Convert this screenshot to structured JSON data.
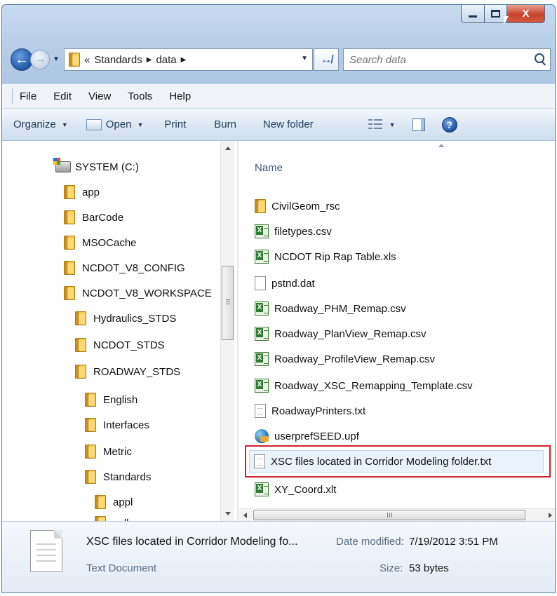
{
  "window": {
    "close_label": "X"
  },
  "address": {
    "overflow": "«",
    "crumbs": [
      "Standards",
      "data"
    ],
    "search_placeholder": "Search data"
  },
  "menu": [
    "File",
    "Edit",
    "View",
    "Tools",
    "Help"
  ],
  "toolbar": {
    "organize": "Organize",
    "open": "Open",
    "print": "Print",
    "burn": "Burn",
    "new_folder": "New folder"
  },
  "nav_tree": [
    {
      "label": "SYSTEM (C:)",
      "type": "drive"
    },
    {
      "label": "app",
      "type": "folder"
    },
    {
      "label": "BarCode",
      "type": "folder"
    },
    {
      "label": "MSOCache",
      "type": "folder"
    },
    {
      "label": "NCDOT_V8_CONFIG",
      "type": "folder"
    },
    {
      "label": "NCDOT_V8_WORKSPACE",
      "type": "folder"
    },
    {
      "label": "Hydraulics_STDS",
      "type": "folder"
    },
    {
      "label": "NCDOT_STDS",
      "type": "folder"
    },
    {
      "label": "ROADWAY_STDS",
      "type": "folder"
    },
    {
      "label": "English",
      "type": "folder"
    },
    {
      "label": "Interfaces",
      "type": "folder"
    },
    {
      "label": "Metric",
      "type": "folder"
    },
    {
      "label": "Standards",
      "type": "folder"
    },
    {
      "label": "appl",
      "type": "folder"
    },
    {
      "label": "cell",
      "type": "folder"
    }
  ],
  "content": {
    "column_name": "Name",
    "files": [
      {
        "name": "CivilGeom_rsc",
        "icon": "folder-icon"
      },
      {
        "name": "filetypes.csv",
        "icon": "excel-icon"
      },
      {
        "name": "NCDOT Rip Rap Table.xls",
        "icon": "excel-icon"
      },
      {
        "name": "pstnd.dat",
        "icon": "blank-file-icon"
      },
      {
        "name": "Roadway_PHM_Remap.csv",
        "icon": "excel-icon"
      },
      {
        "name": "Roadway_PlanView_Remap.csv",
        "icon": "excel-icon"
      },
      {
        "name": "Roadway_ProfileView_Remap.csv",
        "icon": "excel-icon"
      },
      {
        "name": "Roadway_XSC_Remapping_Template.csv",
        "icon": "excel-icon"
      },
      {
        "name": "RoadwayPrinters.txt",
        "icon": "text-file-icon"
      },
      {
        "name": "userprefSEED.upf",
        "icon": "upf-file-icon"
      },
      {
        "name": "XSC files located in Corridor Modeling folder.txt",
        "icon": "text-file-icon",
        "selected": true
      },
      {
        "name": "XY_Coord.xlt",
        "icon": "excel-icon"
      }
    ]
  },
  "details": {
    "name": "XSC files located in Corridor Modeling fo...",
    "type": "Text Document",
    "date_label": "Date modified:",
    "date_value": "7/19/2012 3:51 PM",
    "size_label": "Size:",
    "size_value": "53 bytes"
  },
  "colors": {
    "highlight_border": "#d4202a",
    "selection_fill": "#eaf2fb",
    "chrome_blue": "#b7cde8"
  }
}
